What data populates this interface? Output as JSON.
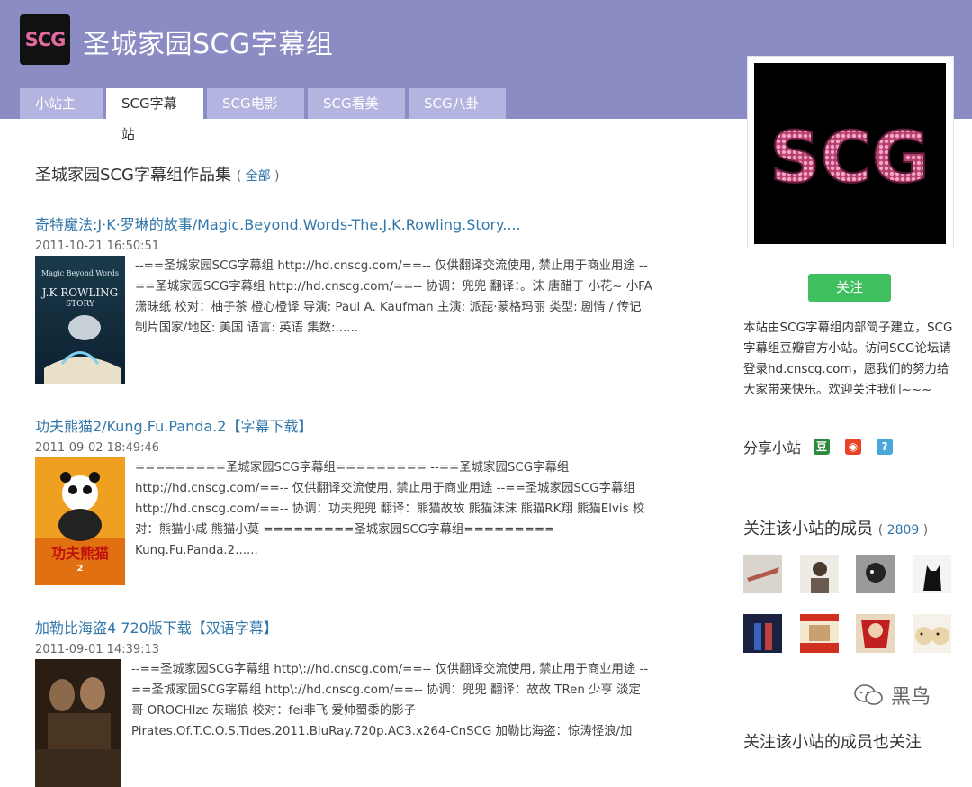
{
  "header": {
    "logo_text": "SCG",
    "site_title": "圣城家园SCG字幕组",
    "tabs": [
      {
        "label": "小站主页",
        "active": false
      },
      {
        "label": "SCG字幕站",
        "active": true
      },
      {
        "label": "SCG电影院",
        "active": false
      },
      {
        "label": "SCG看美剧",
        "active": false
      },
      {
        "label": "SCG八卦街",
        "active": false
      }
    ]
  },
  "main": {
    "section_title": "圣城家园SCG字幕组作品集",
    "all_open": "( ",
    "all_label": "全部",
    "all_close": " )",
    "items": [
      {
        "title": "奇特魔法:J·K·罗琳的故事/Magic.Beyond.Words-The.J.K.Rowling.Story....",
        "date": "2011-10-21 16:50:51",
        "text": "--==圣城家园SCG字幕组 http://hd.cnscg.com/==-- 仅供翻译交流使用, 禁止用于商业用途 --==圣城家园SCG字幕组 http://hd.cnscg.com/==-- 协调：兜兜 翻译：。沫 唐醋于 小花~ 小FA 潇昧纸 校对：柚子茶 橙心橙译 导演: Paul A. Kaufman 主演: 派琵·蒙格玛丽 类型: 剧情 / 传记 制片国家/地区: 美国 语言: 英语 集数:......",
        "thumb": "book-cover"
      },
      {
        "title": "功夫熊猫2/Kung.Fu.Panda.2【字幕下载】",
        "date": "2011-09-02 18:49:46",
        "text": "=========圣城家园SCG字幕组========= --==圣城家园SCG字幕组 http://hd.cnscg.com/==-- 仅供翻译交流使用, 禁止用于商业用途 --==圣城家园SCG字幕组 http://hd.cnscg.com/==-- 协调：功夫兜兜 翻译：熊猫故故 熊猫沫沫 熊猫RK翔 熊猫Elvis 校对：熊猫小咸 熊猫小莫 =========圣城家园SCG字幕组========= Kung.Fu.Panda.2......",
        "thumb": "panda-poster"
      },
      {
        "title": "加勒比海盗4 720版下载【双语字幕】",
        "date": "2011-09-01 14:39:13",
        "text": "--==圣城家园SCG字幕组 http\\://hd.cnscg.com/==-- 仅供翻译交流使用, 禁止用于商业用途 --==圣城家园SCG字幕组 http\\://hd.cnscg.com/==-- 协调：兜兜 翻译：故故 TRen 少亨 淡定哥 OROCHIzc 灰瑞狼 校对：fei非飞 爱帅蜀黍的影子 Pirates.Of.T.C.O.S.Tides.2011.BluRay.720p.AC3.x264-CnSCG 加勒比海盗：惊涛怪浪/加",
        "thumb": "pirates-poster"
      }
    ]
  },
  "side": {
    "cover_text": "SCG",
    "follow_label": "关注",
    "intro": "本站由SCG字幕组内部简子建立，SCG字幕组豆瓣官方小站。访问SCG论坛请登录hd.cnscg.com，愿我们的努力给大家带来快乐。欢迎关注我们~~~",
    "share_label": "分享小站",
    "share_icons": [
      "douban-icon",
      "weibo-icon",
      "qzone-icon"
    ],
    "members_title": "关注该小站的成员",
    "members_count_open": "( ",
    "members_count": "2809",
    "members_count_close": " )",
    "bottom_title": "关注该小站的成员也关注",
    "watermark": "黑鸟"
  },
  "colors": {
    "header_bg": "#8c8cc4",
    "tab_bg": "#b4b4e0",
    "link": "#37a",
    "follow_button": "#3fbf5f"
  }
}
